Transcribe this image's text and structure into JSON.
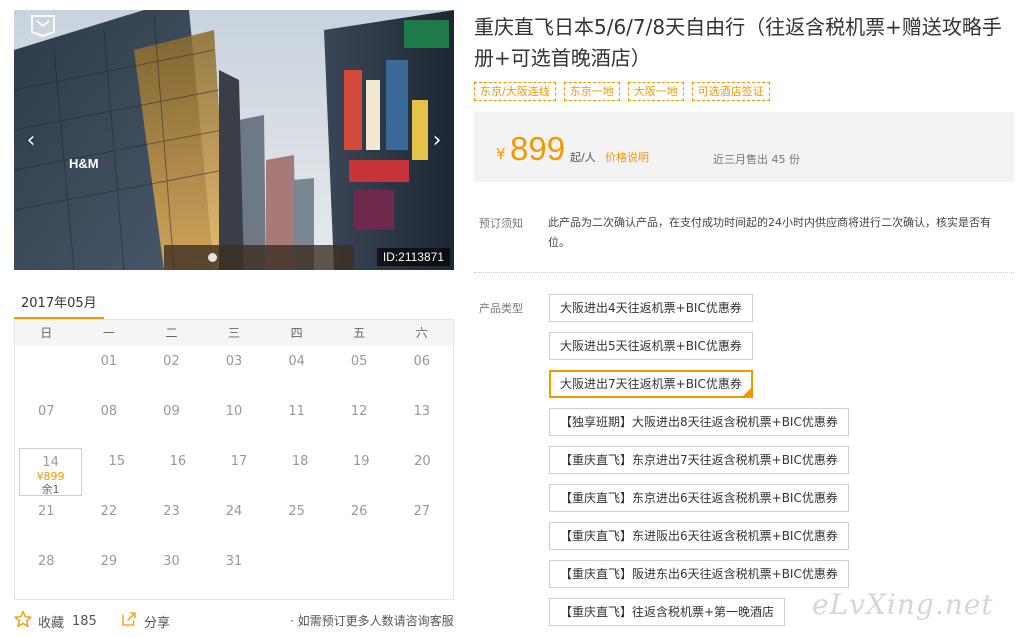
{
  "hero": {
    "image_id": "ID:2113871",
    "prev_arrow": "‹",
    "next_arrow": "›"
  },
  "calendar": {
    "month": "2017年05月",
    "weekdays": [
      "日",
      "一",
      "二",
      "三",
      "四",
      "五",
      "六"
    ],
    "weeks": [
      [
        "",
        "01",
        "02",
        "03",
        "04",
        "05",
        "06"
      ],
      [
        "07",
        "08",
        "09",
        "10",
        "11",
        "12",
        "13"
      ],
      [
        "14",
        "15",
        "16",
        "17",
        "18",
        "19",
        "20"
      ],
      [
        "21",
        "22",
        "23",
        "24",
        "25",
        "26",
        "27"
      ],
      [
        "28",
        "29",
        "30",
        "31",
        "",
        "",
        ""
      ]
    ],
    "available": {
      "date": "14",
      "price": "¥899",
      "stock": "余1"
    }
  },
  "actions": {
    "favorite_label": "收藏",
    "favorite_count": "185",
    "share_label": "分享",
    "consult_text": "· 如需预订更多人数请咨询客服"
  },
  "product": {
    "title": "重庆直飞日本5/6/7/8天自由行（往返含税机票+赠送攻略手册+可选首晚酒店）",
    "tags": [
      "东京/大阪连线",
      "东京一地",
      "大阪一地",
      "可选酒店签证"
    ],
    "price": {
      "currency": "¥",
      "amount": "899",
      "unit": "起/人",
      "note_link": "价格说明",
      "sold": "近三月售出 45 份"
    },
    "notice_label": "预订须知",
    "notice_text": "此产品为二次确认产品，在支付成功时间起的24小时内供应商将进行二次确认，核实是否有位。",
    "type_label": "产品类型",
    "types": [
      "大阪进出4天往返机票+BIC优惠券",
      "大阪进出5天往返机票+BIC优惠券",
      "大阪进出7天往返机票+BIC优惠券",
      "【独享班期】大阪进出8天往返含税机票+BIC优惠券",
      "【重庆直飞】东京进出7天往返含税机票+BIC优惠券",
      "【重庆直飞】东京进出6天往返含税机票+BIC优惠券",
      "【重庆直飞】东进阪出6天往返含税机票+BIC优惠券",
      "【重庆直飞】阪进东出6天往返含税机票+BIC优惠券",
      "【重庆直飞】往返含税机票+第一晚酒店"
    ],
    "selected_type_index": 2
  },
  "watermark": "eLvXing.net",
  "colors": {
    "accent": "#f39800"
  }
}
